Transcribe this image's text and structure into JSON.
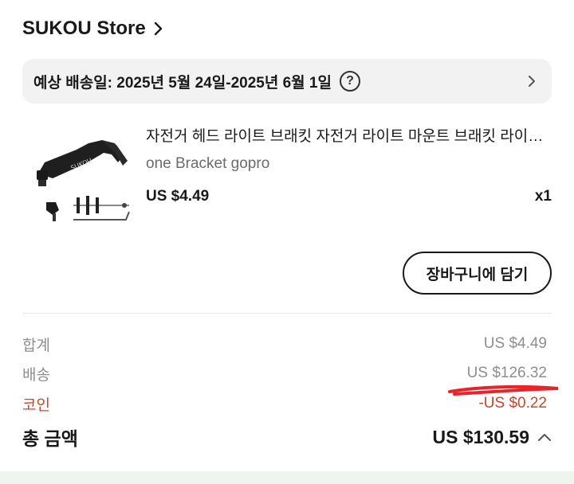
{
  "store": {
    "name": "SUKOU Store"
  },
  "delivery": {
    "text": "예상 배송일: 2025년 5월 24일-2025년 6월 1일",
    "help_glyph": "?"
  },
  "product": {
    "title": "자전거 헤드 라이트 브래킷 자전거 라이트 마운트 브래킷 라이트 마운트",
    "variant": "one Bracket gopro",
    "price": "US $4.49",
    "quantity": "x1"
  },
  "cart_button": {
    "label": "장바구니에 담기"
  },
  "summary": {
    "subtotal": {
      "label": "합계",
      "value": "US $4.49"
    },
    "shipping": {
      "label": "배송",
      "value": "US $126.32"
    },
    "coins": {
      "label": "코인",
      "value": "-US $0.22"
    },
    "total": {
      "label": "총 금액",
      "value": "US $130.59"
    }
  },
  "colors": {
    "text": "#191919",
    "muted": "#8e8e8e",
    "coins": "#c8462a",
    "annotation": "#e8242a",
    "delivery_bg": "#f2f2f2"
  },
  "icons": [
    "chevron-right-icon",
    "help-circle-icon",
    "chevron-up-icon"
  ]
}
